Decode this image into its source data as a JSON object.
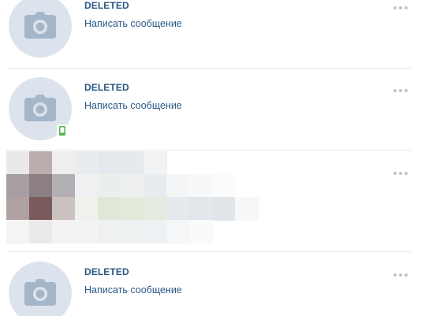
{
  "rows": [
    {
      "name": "DELETED",
      "action_label": "Написать сообщение",
      "mobile": false
    },
    {
      "name": "DELETED",
      "action_label": "Написать сообщение",
      "mobile": true
    },
    {
      "name": "",
      "action_label": "",
      "mobile": false,
      "pixelated": true
    },
    {
      "name": "DELETED",
      "action_label": "Написать сообщение",
      "mobile": false
    }
  ],
  "icons": {
    "avatar_placeholder": "camera-icon",
    "mobile_status": "mobile-phone-icon",
    "more": "more-dots-icon"
  },
  "colors": {
    "link": "#2a5885",
    "avatar_bg": "#dce3ec",
    "camera": "#a6b6c9",
    "mobile_green": "#4bb34b",
    "divider": "#e7e8ec",
    "dots": "#bfc4cc"
  }
}
